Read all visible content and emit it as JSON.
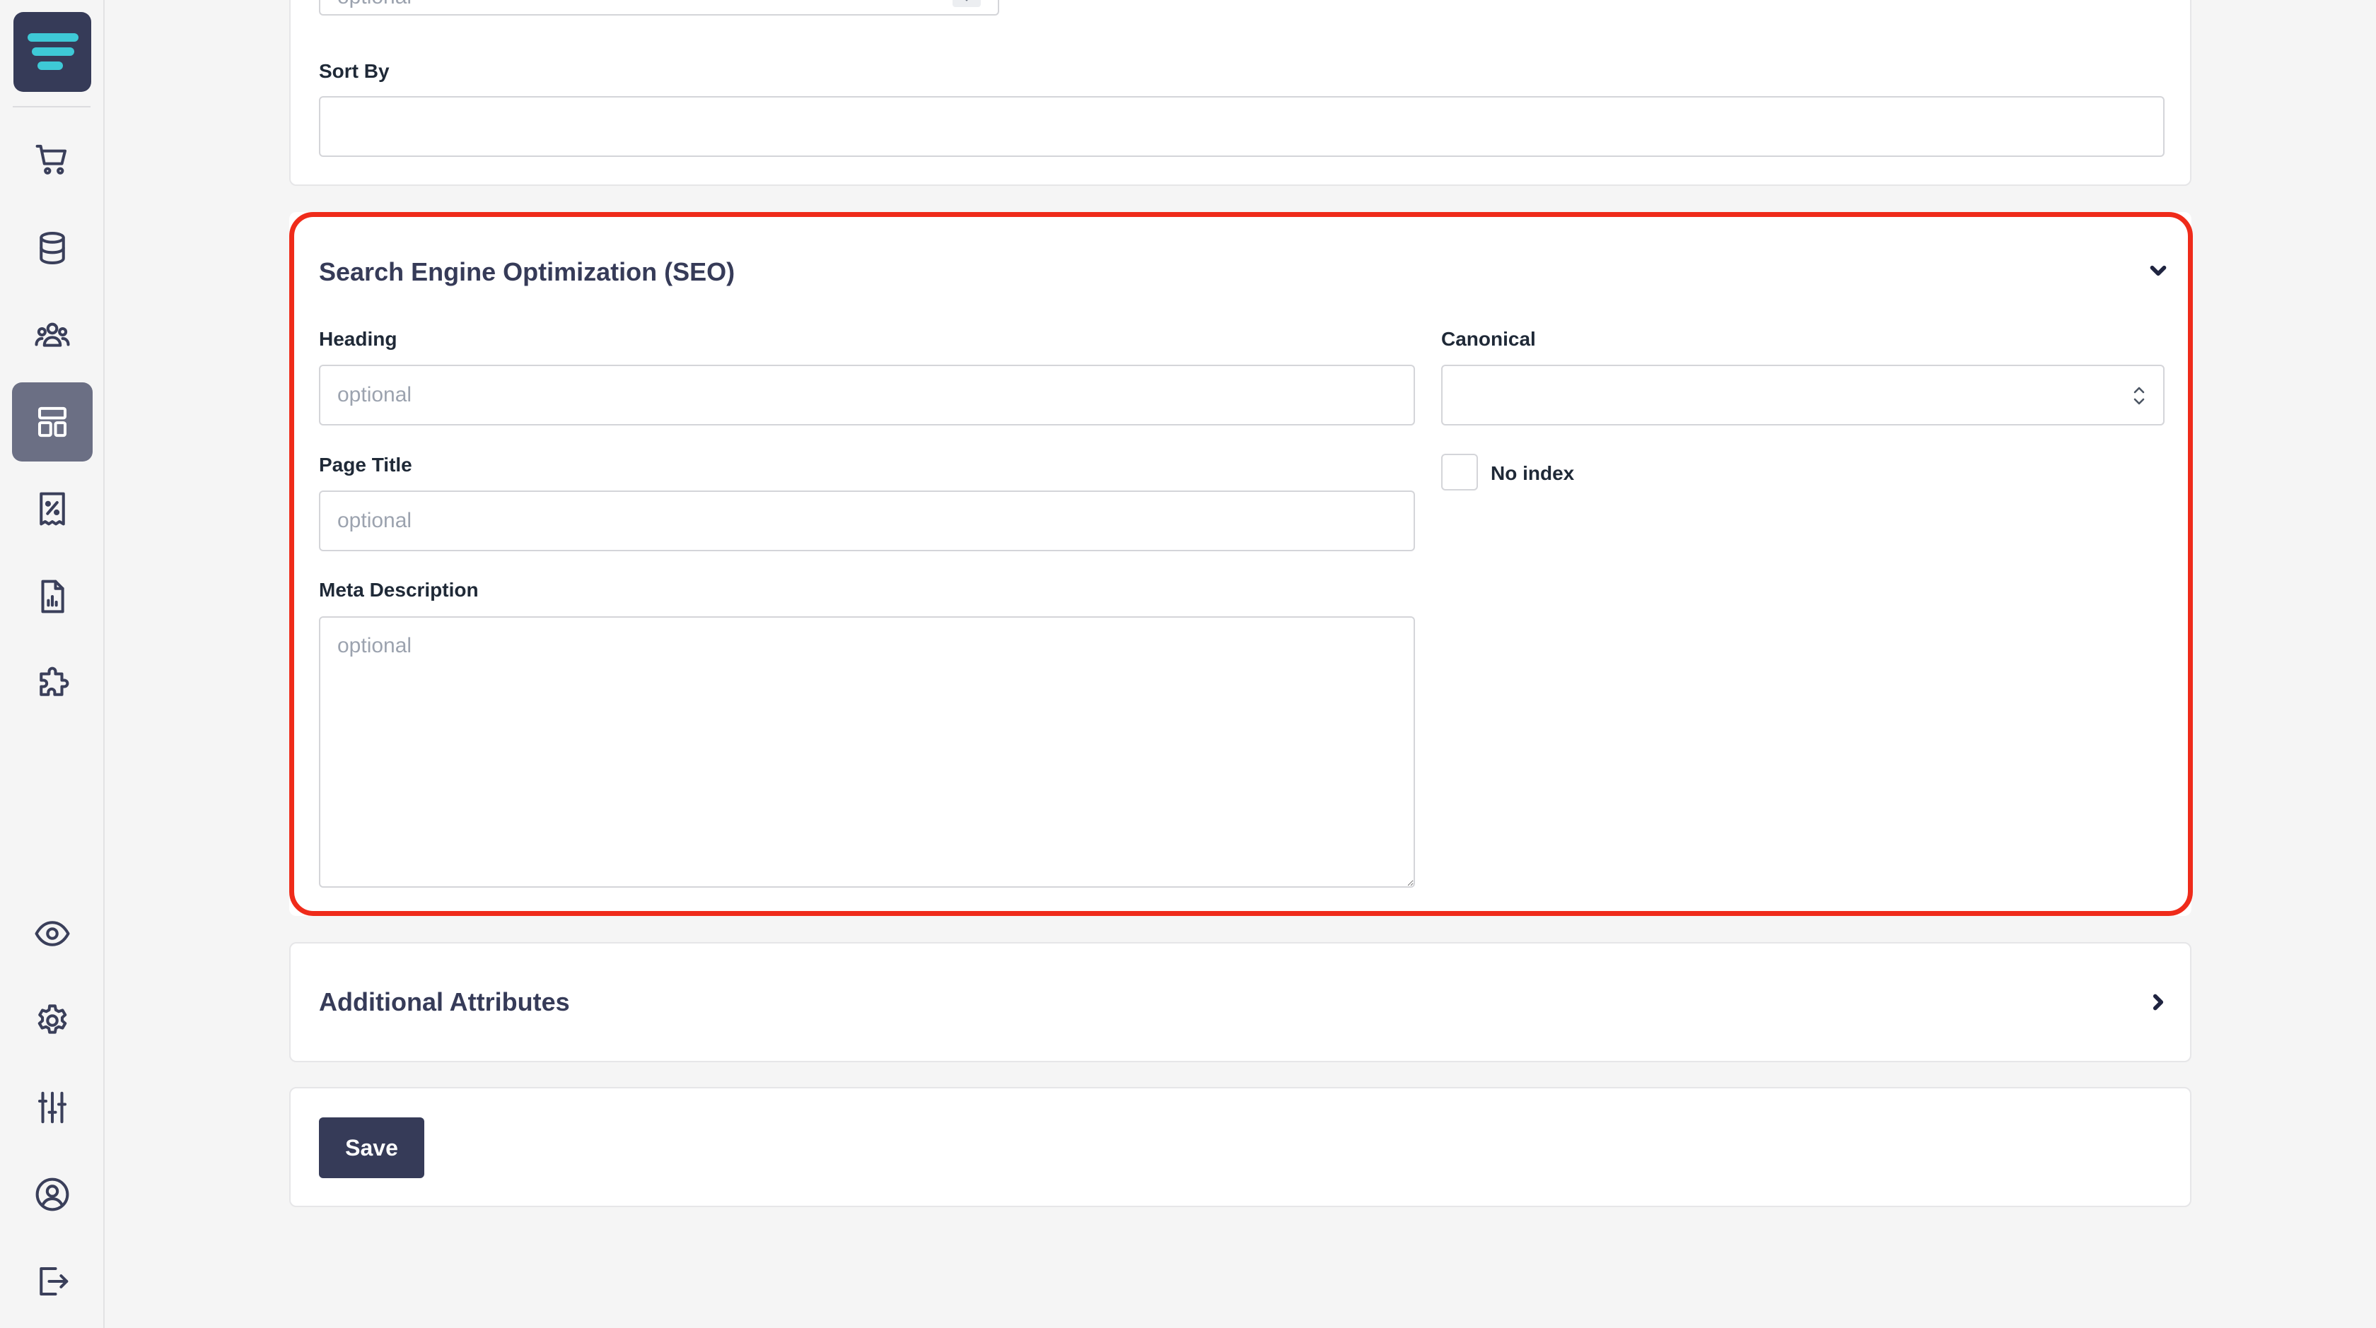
{
  "sidebar": {
    "logo_icon": "brand-logo-icon",
    "items": [
      {
        "name": "sidebar-item-orders",
        "icon": "shopping-cart-icon",
        "active": false
      },
      {
        "name": "sidebar-item-database",
        "icon": "database-icon",
        "active": false
      },
      {
        "name": "sidebar-item-customers",
        "icon": "users-icon",
        "active": false
      },
      {
        "name": "sidebar-item-layout",
        "icon": "layout-icon",
        "active": true
      },
      {
        "name": "sidebar-item-discounts",
        "icon": "receipt-percent-icon",
        "active": false
      },
      {
        "name": "sidebar-item-reports",
        "icon": "report-icon",
        "active": false
      },
      {
        "name": "sidebar-item-extensions",
        "icon": "puzzle-icon",
        "active": false
      },
      {
        "name": "sidebar-item-preview",
        "icon": "eye-icon",
        "active": false
      },
      {
        "name": "sidebar-item-settings",
        "icon": "gear-icon",
        "active": false
      },
      {
        "name": "sidebar-item-adjustments",
        "icon": "sliders-icon",
        "active": false
      },
      {
        "name": "sidebar-item-account",
        "icon": "user-circle-icon",
        "active": false
      },
      {
        "name": "sidebar-item-logout",
        "icon": "logout-icon",
        "active": false
      }
    ]
  },
  "top_card": {
    "cutoff_select_placeholder": "optional",
    "sort_by_label": "Sort By",
    "sort_by_value": ""
  },
  "seo": {
    "title": "Search Engine Optimization (SEO)",
    "heading_label": "Heading",
    "heading_placeholder": "optional",
    "page_title_label": "Page Title",
    "page_title_placeholder": "optional",
    "meta_description_label": "Meta Description",
    "meta_description_placeholder": "optional",
    "canonical_label": "Canonical",
    "canonical_value": "",
    "no_index_label": "No index",
    "no_index_checked": false
  },
  "additional": {
    "title": "Additional Attributes"
  },
  "actions": {
    "save_label": "Save"
  },
  "colors": {
    "accent": "#363b58",
    "highlight": "#ef2b1a"
  }
}
